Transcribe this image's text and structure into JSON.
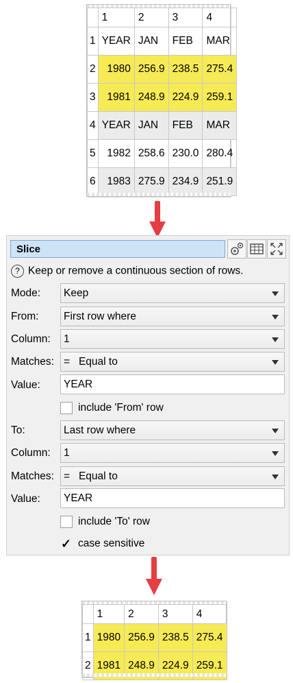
{
  "top_table": {
    "col_headers": [
      "1",
      "2",
      "3",
      "4"
    ],
    "rows": [
      {
        "n": "1",
        "cells": [
          "YEAR",
          "JAN",
          "FEB",
          "MAR"
        ],
        "style": "plain",
        "kind": "txt"
      },
      {
        "n": "2",
        "cells": [
          "1980",
          "256.9",
          "238.5",
          "275.4"
        ],
        "style": "yellow",
        "kind": "num"
      },
      {
        "n": "3",
        "cells": [
          "1981",
          "248.9",
          "224.9",
          "259.1"
        ],
        "style": "yellow",
        "kind": "num"
      },
      {
        "n": "4",
        "cells": [
          "YEAR",
          "JAN",
          "FEB",
          "MAR"
        ],
        "style": "grey",
        "kind": "txt"
      },
      {
        "n": "5",
        "cells": [
          "1982",
          "258.6",
          "230.0",
          "280.4"
        ],
        "style": "plain",
        "kind": "num"
      },
      {
        "n": "6",
        "cells": [
          "1983",
          "275.9",
          "234.9",
          "251.9"
        ],
        "style": "grey",
        "kind": "num"
      }
    ]
  },
  "panel": {
    "title": "Slice",
    "description": "Keep or remove a continuous section of rows.",
    "mode_label": "Mode:",
    "mode_value": "Keep",
    "from_label": "From:",
    "from_value": "First row where",
    "from_column_label": "Column:",
    "from_column_value": "1",
    "from_matches_label": "Matches:",
    "from_matches_value": "=   Equal to",
    "from_value_label": "Value:",
    "from_value_value": "YEAR",
    "include_from_label": "include 'From' row",
    "include_from_checked": false,
    "to_label": "To:",
    "to_value": "Last row where",
    "to_column_label": "Column:",
    "to_column_value": "1",
    "to_matches_label": "Matches:",
    "to_matches_value": "=   Equal to",
    "to_value_label": "Value:",
    "to_value_value": "YEAR",
    "include_to_label": "include 'To' row",
    "include_to_checked": false,
    "case_sensitive_label": "case sensitive",
    "case_sensitive_checked": true,
    "check_glyph": "✓",
    "info_glyph": "?"
  },
  "bottom_table": {
    "col_headers": [
      "1",
      "2",
      "3",
      "4"
    ],
    "rows": [
      {
        "n": "1",
        "cells": [
          "1980",
          "256.9",
          "238.5",
          "275.4"
        ],
        "style": "yellow",
        "kind": "num"
      },
      {
        "n": "2",
        "cells": [
          "1981",
          "248.9",
          "224.9",
          "259.1"
        ],
        "style": "yellow",
        "kind": "num"
      }
    ]
  },
  "colors": {
    "highlight": "#f6ea55",
    "arrow": "#e63e43",
    "title_bg": "#cfe3f7"
  }
}
